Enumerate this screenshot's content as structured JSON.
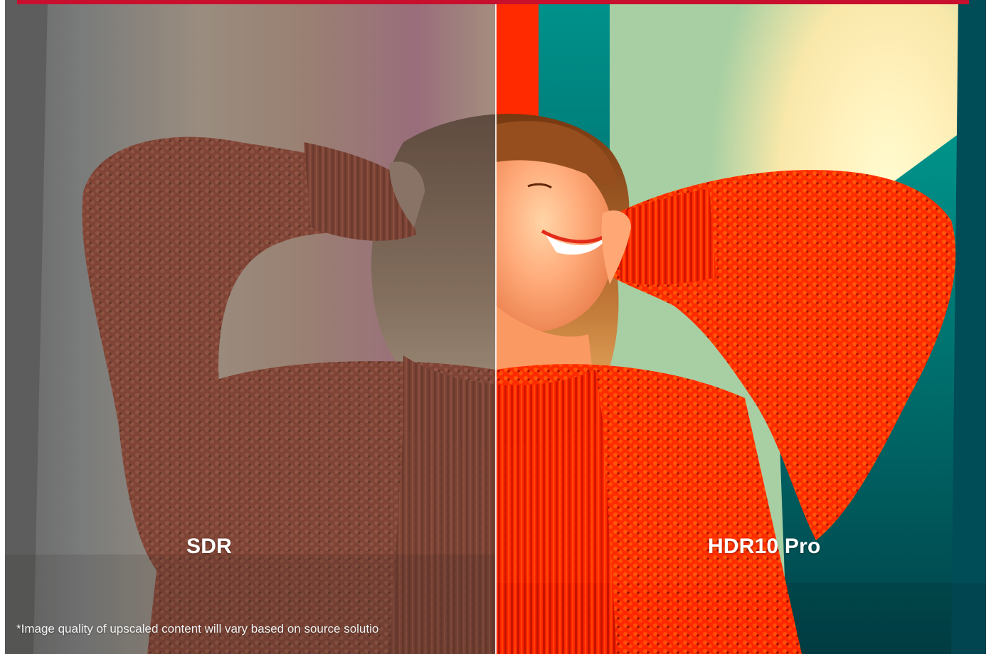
{
  "comparison": {
    "left_label": "SDR",
    "right_label": "HDR10 Pro"
  },
  "footnote": "*Image quality of upscaled content will vary based on source solutio",
  "colors": {
    "top_bar": "#c8102e",
    "sweater": "#e0360f",
    "divider": "#ffffff",
    "label_text": "#ffffff"
  }
}
